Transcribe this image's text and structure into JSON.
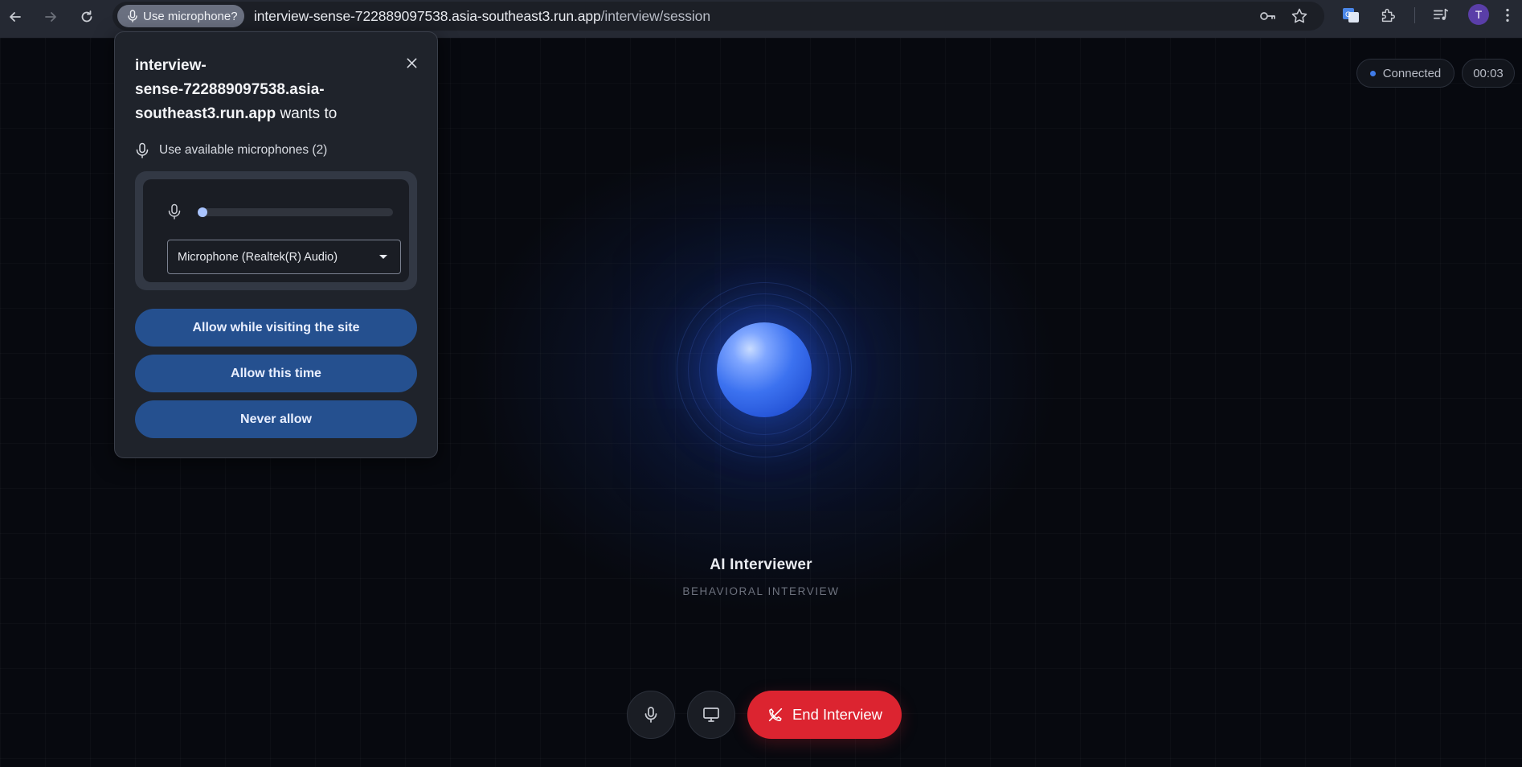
{
  "browser": {
    "permission_chip_label": "Use microphone?",
    "url_host": "interview-sense-722889097538.asia-southeast3.run.app",
    "url_path": "/interview/session",
    "profile_initial": "T"
  },
  "popup": {
    "site_line1": "interview-",
    "site_line2": "sense-722889097538.asia-",
    "site_line3": "southeast3.run.app",
    "wants_to": " wants to",
    "permission_label": "Use available microphones (2)",
    "mic_level": 0.0,
    "selected_device": "Microphone (Realtek(R) Audio)",
    "allow_visiting_label": "Allow while visiting the site",
    "allow_once_label": "Allow this time",
    "never_allow_label": "Never allow"
  },
  "session": {
    "status": "Connected",
    "timer": "00:03",
    "interviewer_title": "AI Interviewer",
    "interview_type": "BEHAVIORAL INTERVIEW",
    "end_label": "End Interview"
  },
  "colors": {
    "accent_blue": "#3c72f0",
    "end_red": "#dc2430",
    "popup_button": "#25508f"
  }
}
